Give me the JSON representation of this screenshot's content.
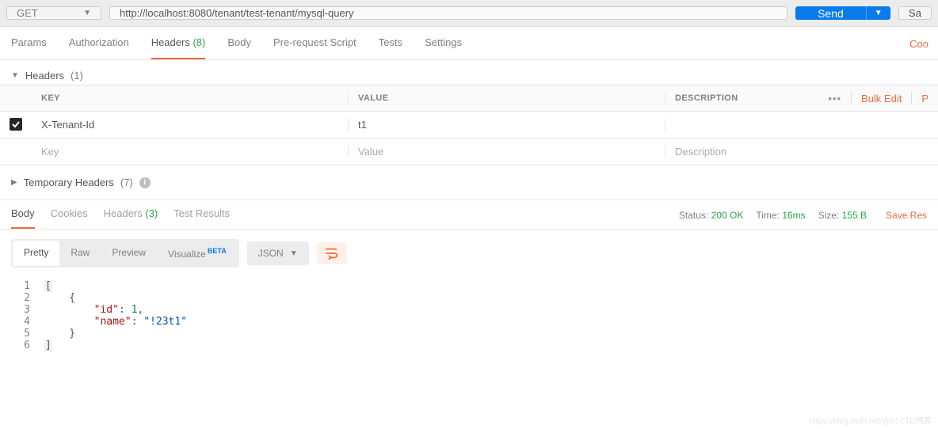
{
  "method": "GET",
  "url": "http://localhost:8080/tenant/test-tenant/mysql-query",
  "send_label": "Send",
  "save_label": "Sa",
  "tabs": {
    "params": "Params",
    "auth": "Authorization",
    "headers": "Headers",
    "headers_count": "(8)",
    "body": "Body",
    "prereq": "Pre-request Script",
    "tests": "Tests",
    "settings": "Settings",
    "cookies": "Coo"
  },
  "headers_section": {
    "title": "Headers",
    "count": "(1)",
    "cols": {
      "key": "KEY",
      "value": "VALUE",
      "desc": "DESCRIPTION"
    },
    "bulk": "Bulk Edit",
    "persist": "P",
    "row": {
      "checked": true,
      "key": "X-Tenant-Id",
      "value": "t1",
      "desc": ""
    },
    "placeholder": {
      "key": "Key",
      "value": "Value",
      "desc": "Description"
    }
  },
  "temp_headers": {
    "title": "Temporary Headers",
    "count": "(7)"
  },
  "response": {
    "tabs": {
      "body": "Body",
      "cookies": "Cookies",
      "headers": "Headers",
      "headers_count": "(3)",
      "tests": "Test Results"
    },
    "status_label": "Status:",
    "status_value": "200 OK",
    "time_label": "Time:",
    "time_value": "16ms",
    "size_label": "Size:",
    "size_value": "155 B",
    "save_response": "Save Res"
  },
  "format": {
    "pretty": "Pretty",
    "raw": "Raw",
    "preview": "Preview",
    "visualize": "Visualize",
    "beta": "BETA",
    "json": "JSON"
  },
  "json_body": {
    "lines": [
      "[",
      "    {",
      "        \"id\": 1,",
      "        \"name\": \"!23t1\"",
      "    }",
      "]"
    ],
    "fields": {
      "id_key": "\"id\"",
      "id_val": "1",
      "name_key": "\"name\"",
      "name_val": "\"!23t1\""
    }
  },
  "watermark": "https://blog.csdn.net/@61CTO博客"
}
